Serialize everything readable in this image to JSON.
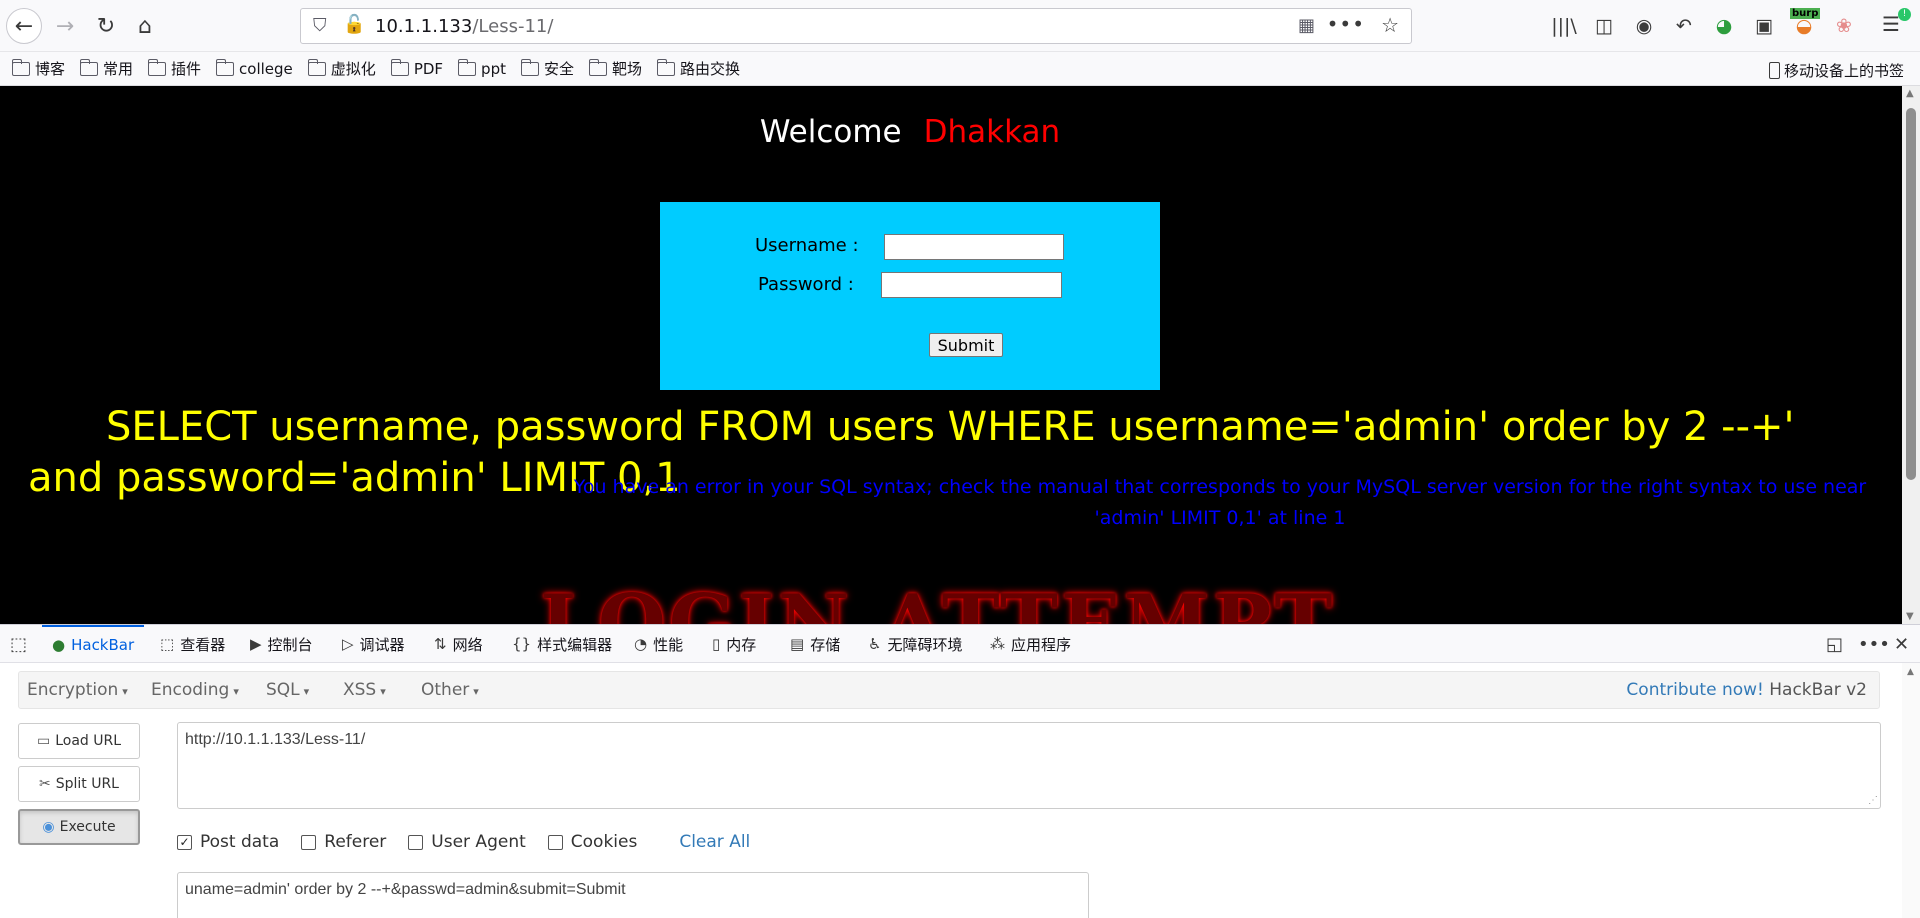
{
  "browser": {
    "url_host": "10.1.1.133",
    "url_path": "/Less-11/",
    "menu_badge": "!",
    "burp_label": "burp"
  },
  "bookmarks": [
    {
      "label": "博客"
    },
    {
      "label": "常用"
    },
    {
      "label": "插件"
    },
    {
      "label": "college"
    },
    {
      "label": "虚拟化"
    },
    {
      "label": "PDF"
    },
    {
      "label": "ppt"
    },
    {
      "label": "安全"
    },
    {
      "label": "靶场"
    },
    {
      "label": "路由交换"
    }
  ],
  "mobile_bookmarks": "移动设备上的书签",
  "page": {
    "welcome": "Welcome",
    "username_display": "Dhakkan",
    "username_label": "Username :",
    "password_label": "Password :",
    "submit_label": "Submit",
    "query_text": "SELECT username, password FROM users WHERE username='admin' order by 2 --+' and password='admin' LIMIT 0,1",
    "sql_error": "You have an error in your SQL syntax; check the manual that corresponds to your MySQL server version for the right syntax to use near 'admin' LIMIT 0,1' at line 1",
    "banner_text": "LOGIN ATTEMPT"
  },
  "devtools": {
    "tabs": [
      {
        "label": "HackBar",
        "icon": "hackbar-icon"
      },
      {
        "label": "查看器",
        "icon": "inspector-icon"
      },
      {
        "label": "控制台",
        "icon": "console-icon"
      },
      {
        "label": "调试器",
        "icon": "debugger-icon"
      },
      {
        "label": "网络",
        "icon": "network-icon"
      },
      {
        "label": "样式编辑器",
        "icon": "style-editor-icon"
      },
      {
        "label": "性能",
        "icon": "performance-icon"
      },
      {
        "label": "内存",
        "icon": "memory-icon"
      },
      {
        "label": "存储",
        "icon": "storage-icon"
      },
      {
        "label": "无障碍环境",
        "icon": "accessibility-icon"
      },
      {
        "label": "应用程序",
        "icon": "application-icon"
      }
    ],
    "active_tab": "HackBar"
  },
  "hackbar": {
    "menus": [
      "Encryption",
      "Encoding",
      "SQL",
      "XSS",
      "Other"
    ],
    "contribute_link": "Contribute now!",
    "version": "HackBar v2",
    "load_url": "Load URL",
    "split_url": "Split URL",
    "execute": "Execute",
    "url_value": "http://10.1.1.133/Less-11/",
    "checkboxes": [
      {
        "label": "Post data",
        "checked": true
      },
      {
        "label": "Referer",
        "checked": false
      },
      {
        "label": "User Agent",
        "checked": false
      },
      {
        "label": "Cookies",
        "checked": false
      }
    ],
    "clear_all": "Clear All",
    "post_value": "uname=admin' order by 2 --+&passwd=admin&submit=Submit"
  }
}
